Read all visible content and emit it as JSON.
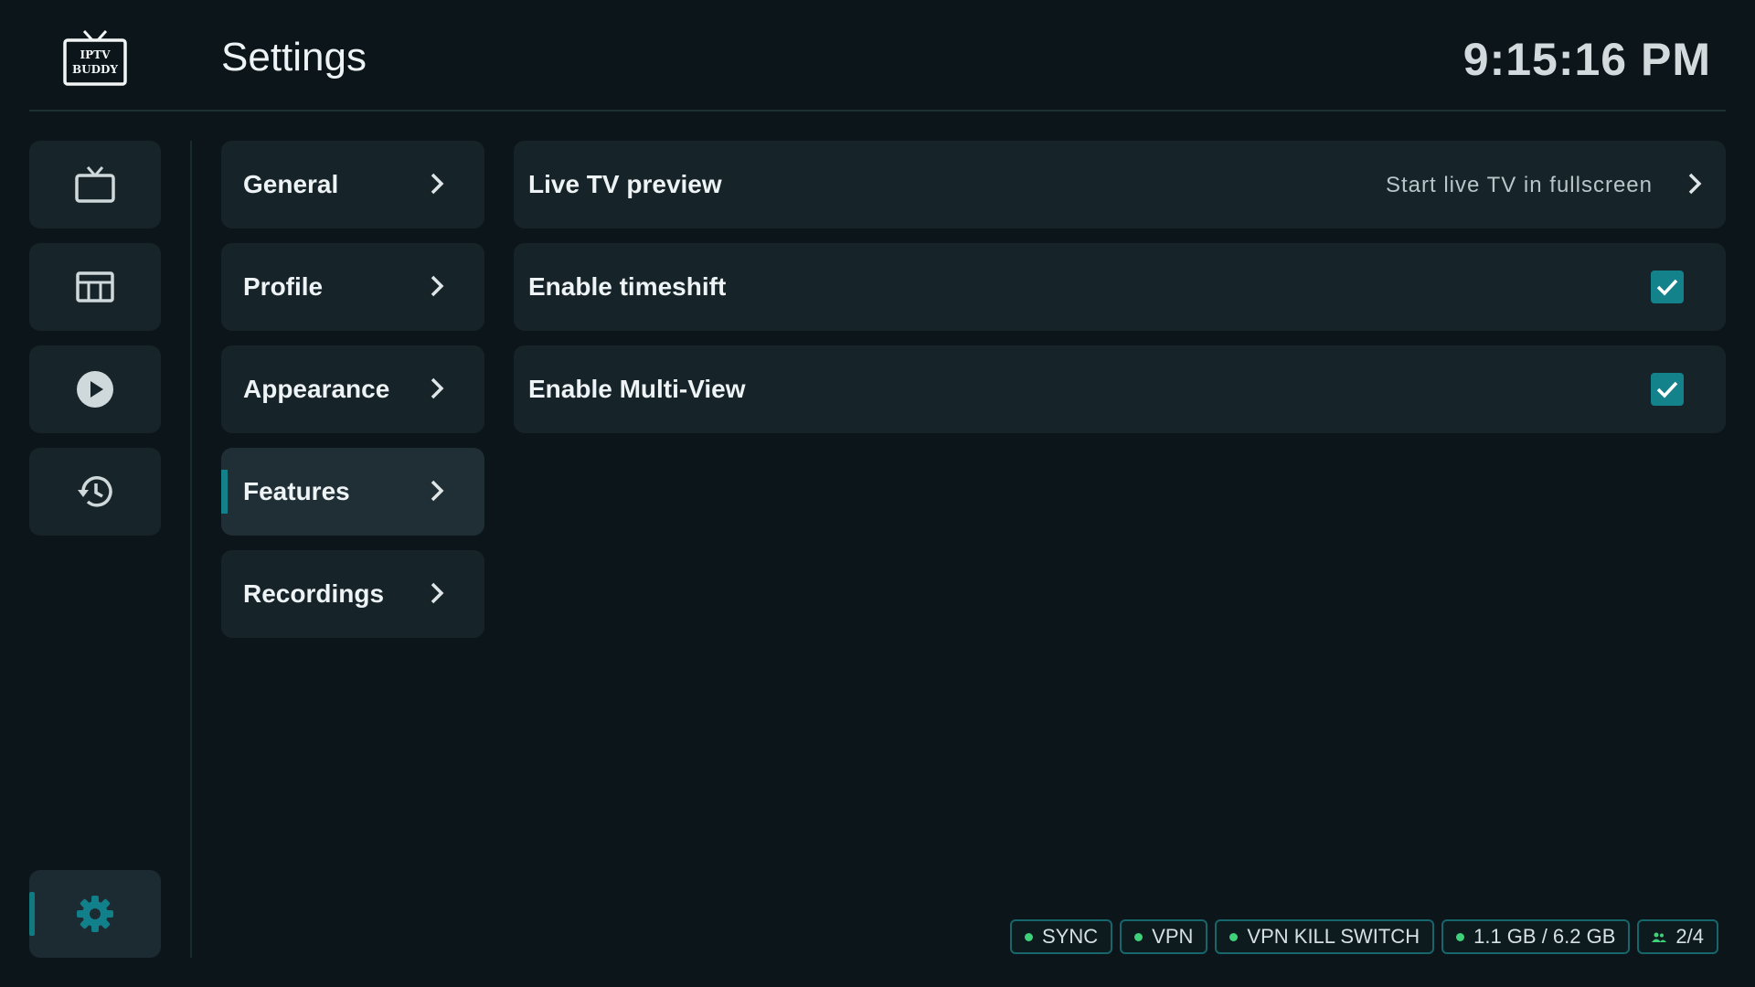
{
  "header": {
    "logo_text_line1": "IPTV",
    "logo_text_line2": "BUDDY",
    "title": "Settings",
    "clock": "9:15:16 PM"
  },
  "rail": {
    "items": [
      {
        "icon": "tv-icon"
      },
      {
        "icon": "guide-grid-icon"
      },
      {
        "icon": "play-icon"
      },
      {
        "icon": "history-icon"
      }
    ],
    "bottom": {
      "icon": "gear-icon",
      "active": true
    }
  },
  "menu": {
    "items": [
      {
        "label": "General"
      },
      {
        "label": "Profile"
      },
      {
        "label": "Appearance"
      },
      {
        "label": "Features",
        "selected": true
      },
      {
        "label": "Recordings"
      }
    ]
  },
  "settings": {
    "rows": [
      {
        "title": "Live TV preview",
        "value": "Start live TV in fullscreen"
      },
      {
        "title": "Enable timeshift",
        "checked": true
      },
      {
        "title": "Enable Multi-View",
        "checked": true
      }
    ]
  },
  "status": {
    "sync": "SYNC",
    "vpn": "VPN",
    "kill_switch": "VPN KILL SWITCH",
    "storage": "1.1 GB / 6.2 GB",
    "users": "2/4"
  },
  "colors": {
    "background": "#0c1519",
    "card": "#162328",
    "accent": "#14828b",
    "status_dot": "#3ed17a"
  }
}
